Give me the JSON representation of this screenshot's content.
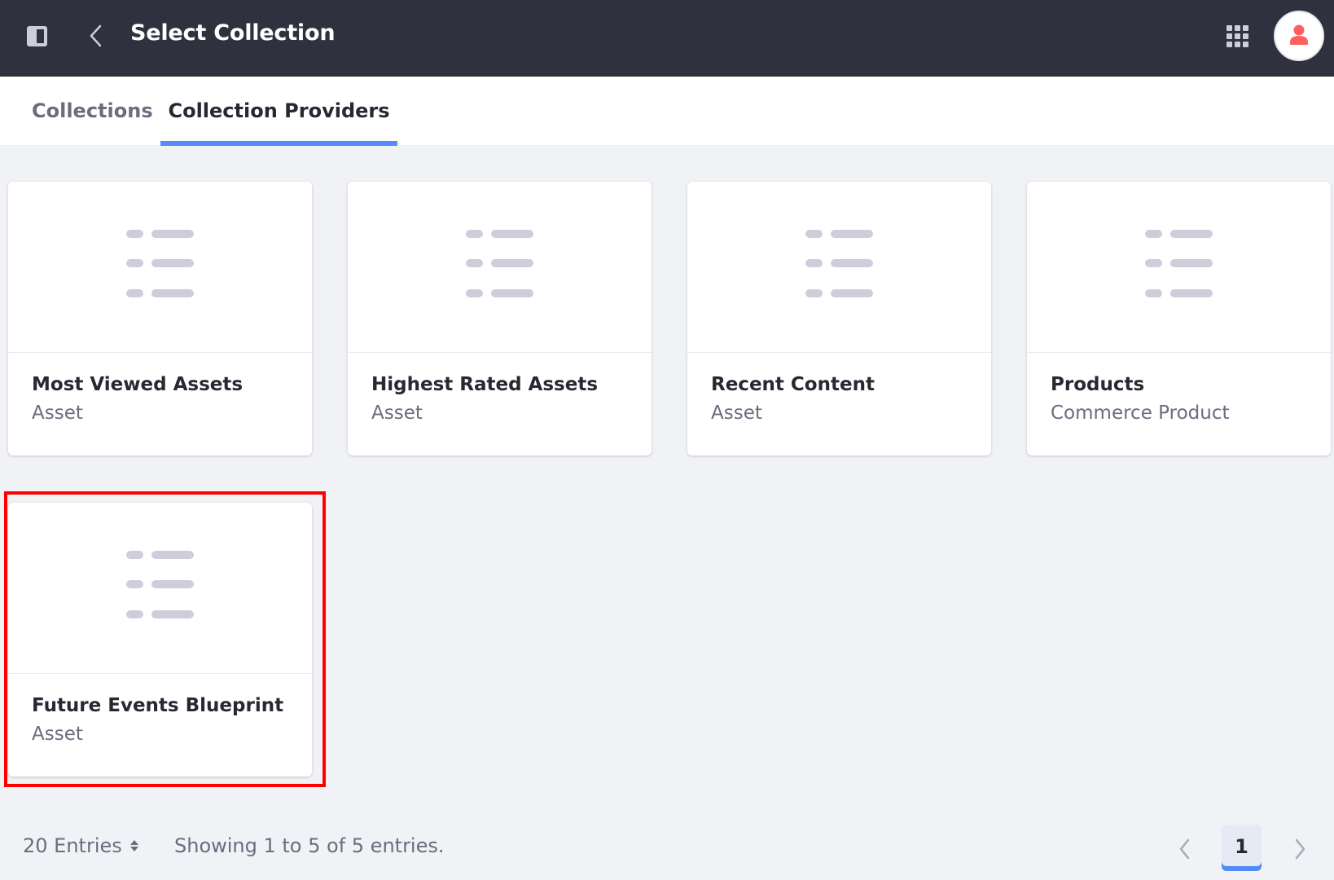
{
  "header": {
    "title": "Select Collection",
    "icons": {
      "sidebar_toggle": "sidebar-toggle-icon",
      "back": "chevron-left-icon",
      "apps": "grid-icon",
      "user": "user-icon"
    },
    "colors": {
      "background": "#30313f",
      "avatar_icon": "#ff5f5f"
    }
  },
  "tabs": [
    {
      "label": "Collections",
      "active": false
    },
    {
      "label": "Collection Providers",
      "active": true
    }
  ],
  "accent_color": "#528cf8",
  "cards": [
    {
      "title": "Most Viewed Assets",
      "subtitle": "Asset",
      "icon": "list-icon"
    },
    {
      "title": "Highest Rated Assets",
      "subtitle": "Asset",
      "icon": "list-icon"
    },
    {
      "title": "Recent Content",
      "subtitle": "Asset",
      "icon": "list-icon"
    },
    {
      "title": "Products",
      "subtitle": "Commerce Product",
      "icon": "list-icon"
    },
    {
      "title": "Future Events Blueprint",
      "subtitle": "Asset",
      "icon": "list-icon",
      "highlighted": true
    }
  ],
  "footer": {
    "entries_label": "20 Entries",
    "showing_text": "Showing 1 to 5 of 5 entries.",
    "current_page": "1"
  }
}
